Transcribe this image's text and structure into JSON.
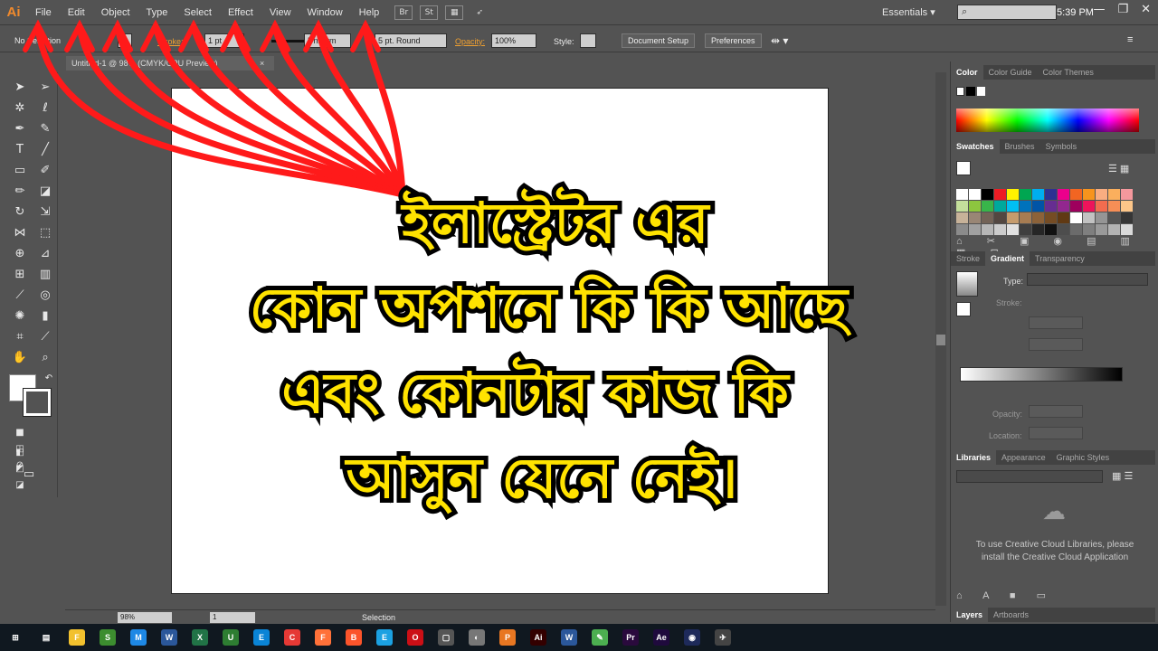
{
  "app": {
    "logo": "Ai",
    "menu": [
      "File",
      "Edit",
      "Object",
      "Type",
      "Select",
      "Effect",
      "View",
      "Window",
      "Help"
    ],
    "workspace": "Essentials",
    "window_buttons": [
      "—",
      "❐",
      "✕"
    ]
  },
  "control": {
    "selection": "No Selection",
    "stroke_label": "Stroke:",
    "stroke_weight": "1 pt",
    "stroke_profile": "Uniform",
    "brush": "5 pt. Round",
    "opacity_label": "Opacity:",
    "opacity_value": "100%",
    "style_label": "Style:",
    "document_setup": "Document Setup",
    "preferences": "Preferences"
  },
  "document": {
    "tab_title": "Untitled-1 @ 98% (CMYK/GPU Preview)",
    "tab_close": "×"
  },
  "overlay": {
    "lines": [
      "ইলাস্ট্রেটর এর",
      "কোন অপশনে কি কি আছে",
      "এবং কোনটার কাজ কি",
      "আসুন যেনে নেই।"
    ],
    "text_color": "#ffe300",
    "outline_color": "#000000",
    "arrow_color": "#ff1a1a"
  },
  "panels": {
    "color_tabs": [
      "Color",
      "Color Guide",
      "Color Themes"
    ],
    "swatch_tabs": [
      "Swatches",
      "Brushes",
      "Symbols"
    ],
    "stroke_tabs": [
      "Stroke",
      "Gradient",
      "Transparency"
    ],
    "gradient": {
      "type_label": "Type:",
      "stroke_label": "Stroke:",
      "opacity_label": "Opacity:",
      "location_label": "Location:"
    },
    "library_tabs": [
      "Libraries",
      "Appearance",
      "Graphic Styles"
    ],
    "library_message": "To use Creative Cloud Libraries, please install the Creative Cloud Application",
    "layer_tabs": [
      "Layers",
      "Artboards"
    ],
    "swatch_colors": [
      "#ffffff",
      "#ffffff",
      "#000000",
      "#ed1c24",
      "#fff200",
      "#00a651",
      "#00aeef",
      "#2e3192",
      "#ec008c",
      "#f26522",
      "#f7941d",
      "#f9ad81",
      "#fbaf5d",
      "#f5989d",
      "#c4df9b",
      "#8dc63f",
      "#39b54a",
      "#00a99d",
      "#00bff3",
      "#0072bc",
      "#0054a6",
      "#662d91",
      "#92278f",
      "#9e005d",
      "#ed145b",
      "#f26c4f",
      "#f68e56",
      "#fdc689",
      "#c7b299",
      "#998675",
      "#736357",
      "#534741",
      "#c69c6d",
      "#a67c52",
      "#8c6239",
      "#754c24",
      "#603913",
      "#ffffff",
      "#c2c2c2",
      "#959595",
      "#555555",
      "#363636",
      "#8b8b8b",
      "#a0a0a0",
      "#b7b7b7",
      "#cccccc",
      "#e1e1e1",
      "#3f3f3f",
      "#262626",
      "#111111",
      "#4d4d4d",
      "#6b6b6b",
      "#7f7f7f",
      "#999999",
      "#b3b3b3",
      "#d9d9d9"
    ]
  },
  "status": {
    "zoom": "98%",
    "page": "1",
    "tool": "Selection"
  },
  "taskbar": {
    "time": "5:39 PM",
    "apps": [
      {
        "label": "⊞",
        "color": "#101820"
      },
      {
        "label": "▤",
        "color": "#101820"
      },
      {
        "label": "F",
        "color": "#f2c12e"
      },
      {
        "label": "S",
        "color": "#3c8d2f"
      },
      {
        "label": "M",
        "color": "#1e88e5"
      },
      {
        "label": "W",
        "color": "#2b579a"
      },
      {
        "label": "X",
        "color": "#217346"
      },
      {
        "label": "U",
        "color": "#2e7d32"
      },
      {
        "label": "E",
        "color": "#0a84d6"
      },
      {
        "label": "C",
        "color": "#e53935"
      },
      {
        "label": "F",
        "color": "#ff7139"
      },
      {
        "label": "B",
        "color": "#fb542b"
      },
      {
        "label": "E",
        "color": "#1ba1e2"
      },
      {
        "label": "O",
        "color": "#cc0f16"
      },
      {
        "label": "▢",
        "color": "#555555"
      },
      {
        "label": "◐",
        "color": "#777777"
      },
      {
        "label": "P",
        "color": "#e87722"
      },
      {
        "label": "Ai",
        "color": "#330000"
      },
      {
        "label": "W",
        "color": "#2b579a"
      },
      {
        "label": "✎",
        "color": "#4caf50"
      },
      {
        "label": "Pr",
        "color": "#2a0a3d"
      },
      {
        "label": "Ae",
        "color": "#1f0a3d"
      },
      {
        "label": "◉",
        "color": "#1e2a5a"
      },
      {
        "label": "✈",
        "color": "#444444"
      }
    ]
  }
}
